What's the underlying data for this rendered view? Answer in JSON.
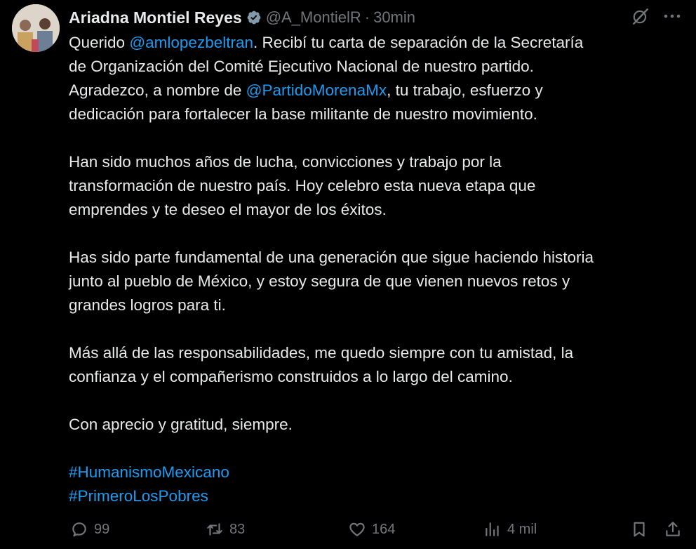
{
  "author": {
    "name": "Ariadna Montiel Reyes",
    "handle": "@A_MontielR",
    "separator": "·",
    "time": "30min"
  },
  "colors": {
    "background": "#000000",
    "text": "#e7e9ea",
    "secondary": "#71767b",
    "link": "#1d9bf0",
    "verified": "#829aab"
  },
  "icons": {
    "verified": "verified-badge-icon",
    "grok": "grok-icon",
    "more": "more-icon",
    "reply": "reply-icon",
    "retweet": "retweet-icon",
    "like": "heart-icon",
    "views": "views-icon",
    "bookmark": "bookmark-icon",
    "share": "share-icon"
  },
  "tweet": {
    "p1": {
      "l1_a": "Querido ",
      "l1_mention": "@amlopezbeltran",
      "l1_b": ". Recibí tu carta de separación de la Secretaría",
      "l2": "de Organización del Comité Ejecutivo Nacional de nuestro partido.",
      "l3_a": "Agradezco, a nombre de ",
      "l3_mention": "@PartidoMorenaMx",
      "l3_b": ", tu trabajo, esfuerzo y",
      "l4": "dedicación para fortalecer la base militante de nuestro movimiento."
    },
    "p2": [
      "Han sido muchos años de lucha, convicciones y trabajo por la",
      "transformación de nuestro país. Hoy celebro esta nueva etapa que",
      "emprendes y te deseo el mayor de los éxitos."
    ],
    "p3": [
      "Has sido parte fundamental de una generación que sigue haciendo historia",
      "junto al pueblo de México, y estoy segura de que vienen nuevos retos y",
      "grandes logros para ti."
    ],
    "p4": [
      "Más allá de las responsabilidades, me quedo siempre con tu amistad, la",
      "confianza y el compañerismo construidos a lo largo del camino."
    ],
    "p5": "Con aprecio y gratitud, siempre.",
    "hashtags": [
      "#HumanismoMexicano",
      "#PrimeroLosPobres"
    ]
  },
  "metrics": {
    "replies": "99",
    "retweets": "83",
    "likes": "164",
    "views": "4 mil"
  }
}
